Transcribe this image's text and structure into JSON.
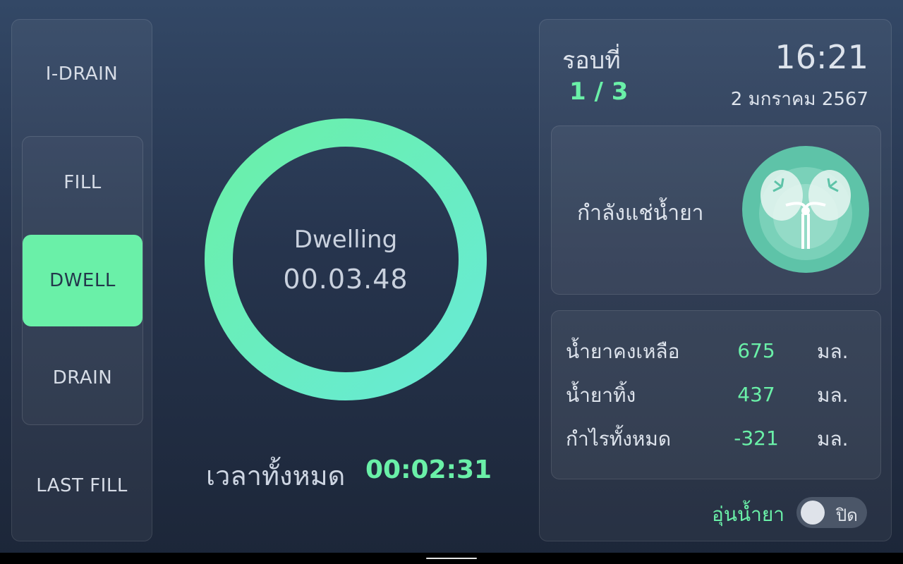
{
  "sidebar": {
    "phases": {
      "idrain": "I-DRAIN",
      "fill": "FILL",
      "dwell": "DWELL",
      "drain": "DRAIN",
      "last_fill": "LAST FILL"
    },
    "active_phase": "DWELL"
  },
  "timer": {
    "status": "Dwelling",
    "remaining": "00.03.48"
  },
  "total": {
    "label": "เวลาทั้งหมด",
    "value": "00:02:31"
  },
  "cycle": {
    "label": "รอบที่",
    "value": "1 / 3"
  },
  "clock": {
    "time": "16:21",
    "date": "2 มกราคม 2567"
  },
  "status_card": {
    "text": "กำลังแช่น้ำยา",
    "icon": "kidney-icon"
  },
  "stats": [
    {
      "label": "น้ำยาคงเหลือ",
      "value": "675",
      "unit": "มล."
    },
    {
      "label": "น้ำยาทิ้ง",
      "value": "437",
      "unit": "มล."
    },
    {
      "label": "กำไรทั้งหมด",
      "value": "-321",
      "unit": "มล."
    }
  ],
  "warmer": {
    "label": "อุ่นน้ำยา",
    "state": "ปิด",
    "on": false
  },
  "colors": {
    "accent": "#6af0a8",
    "accent_teal": "#68ead6",
    "background_top": "#334866",
    "background_bottom": "#1c2638",
    "dwell_text": "#24374c"
  }
}
